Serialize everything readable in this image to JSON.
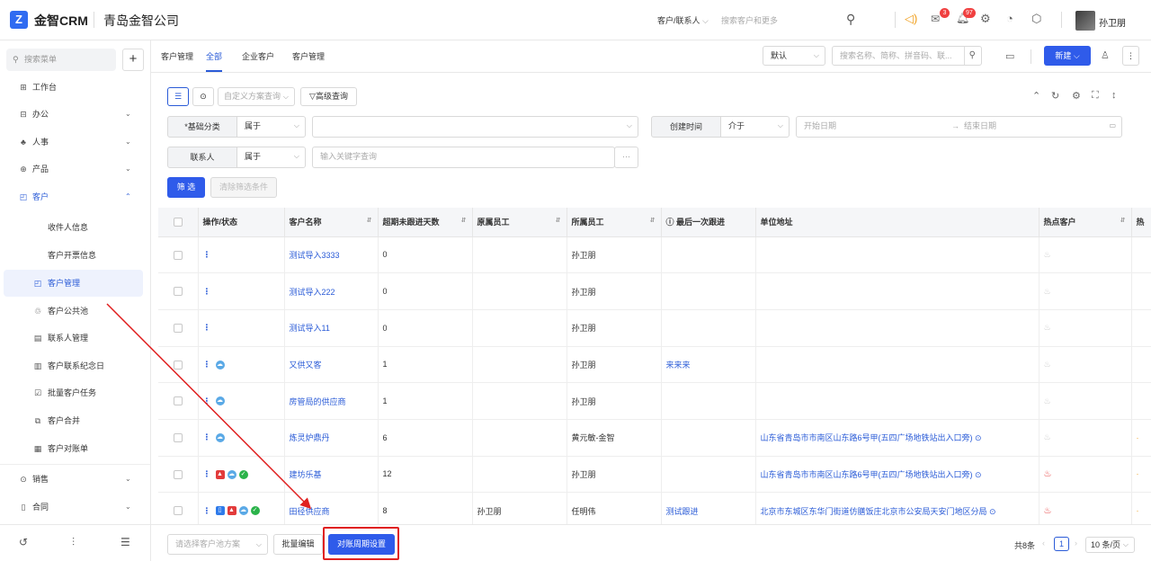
{
  "app": {
    "logo_letter": "Z",
    "name": "金智CRM",
    "company": "青岛金智公司"
  },
  "topbar": {
    "filter_label": "客户/联系人",
    "search_placeholder": "搜索客户和更多",
    "mail_badge": "3",
    "notify_badge": "97",
    "username": "孙卫朋"
  },
  "sidebar": {
    "search_placeholder": "搜索菜单",
    "items": [
      {
        "icon": "⊞",
        "label": "工作台"
      },
      {
        "icon": "⊟",
        "label": "办公"
      },
      {
        "icon": "♣",
        "label": "人事"
      },
      {
        "icon": "⊕",
        "label": "产品"
      },
      {
        "icon": "◰",
        "label": "客户"
      }
    ],
    "sub_items": [
      {
        "icon": "",
        "label": "收件人信息"
      },
      {
        "icon": "",
        "label": "客户开票信息"
      },
      {
        "icon": "◰",
        "label": "客户管理"
      },
      {
        "icon": "♲",
        "label": "客户公共池"
      },
      {
        "icon": "▤",
        "label": "联系人管理"
      },
      {
        "icon": "▥",
        "label": "客户联系纪念日"
      },
      {
        "icon": "☑",
        "label": "批量客户任务"
      },
      {
        "icon": "⧉",
        "label": "客户合并"
      },
      {
        "icon": "▦",
        "label": "客户对账单"
      }
    ],
    "tail_items": [
      {
        "icon": "⊙",
        "label": "销售"
      },
      {
        "icon": "▯",
        "label": "合同"
      }
    ]
  },
  "tabs": {
    "title": "客户管理",
    "items": [
      "全部",
      "企业客户",
      "客户管理"
    ],
    "view_select": "默认",
    "search_placeholder": "搜索名称、简称、拼音码、联...",
    "new_button": "新建"
  },
  "filters": {
    "scheme_placeholder": "自定义方案查询",
    "advanced": "高级查询",
    "base_category_label": "*基础分类",
    "base_op": "属于",
    "created_label": "创建时间",
    "created_op": "介于",
    "start_placeholder": "开始日期",
    "end_placeholder": "结束日期",
    "contact_label": "联系人",
    "contact_op": "属于",
    "keyword_placeholder": "输入关键字查询",
    "filter_btn": "筛 选",
    "clear_btn": "清除筛选条件"
  },
  "table": {
    "columns": [
      "操作/状态",
      "客户名称",
      "超期未跟进天数",
      "原属员工",
      "所属员工",
      "最后一次跟进",
      "单位地址",
      "热点客户",
      "热"
    ],
    "rows": [
      {
        "status": [],
        "name": "测试导入3333",
        "days": "0",
        "orig": "",
        "owner": "孙卫朋",
        "last": "",
        "addr": "",
        "hot": "grey"
      },
      {
        "status": [],
        "name": "测试导入222",
        "days": "0",
        "orig": "",
        "owner": "孙卫朋",
        "last": "",
        "addr": "",
        "hot": "grey"
      },
      {
        "status": [],
        "name": "测试导入11",
        "days": "0",
        "orig": "",
        "owner": "孙卫朋",
        "last": "",
        "addr": "",
        "hot": "grey"
      },
      {
        "status": [
          "lb"
        ],
        "name": "又供又客",
        "days": "1",
        "orig": "",
        "owner": "孙卫朋",
        "last": "来来来",
        "addr": "",
        "hot": "grey"
      },
      {
        "status": [
          "lb"
        ],
        "name": "房管局的供应商",
        "days": "1",
        "orig": "",
        "owner": "孙卫朋",
        "last": "",
        "addr": "",
        "hot": "grey"
      },
      {
        "status": [
          "lb"
        ],
        "name": "炼灵炉鼎丹",
        "days": "6",
        "orig": "",
        "owner": "黄元敏-金智",
        "last": "",
        "addr": "山东省青岛市市南区山东路6号甲(五四广场地铁站出入口旁)",
        "hot": "grey"
      },
      {
        "status": [
          "red",
          "lb",
          "green"
        ],
        "name": "建坊乐基",
        "days": "12",
        "orig": "",
        "owner": "孙卫朋",
        "last": "",
        "addr": "山东省青岛市市南区山东路6号甲(五四广场地铁站出入口旁)",
        "hot": "red"
      },
      {
        "status": [
          "blue",
          "red",
          "lb",
          "green"
        ],
        "name": "田径供应商",
        "days": "8",
        "orig": "孙卫朋",
        "owner": "任明伟",
        "last": "测试跟进",
        "addr": "北京市东城区东华门街道仿膳饭庄北京市公安局天安门地区分局",
        "hot": "red"
      }
    ]
  },
  "bottom": {
    "pool_placeholder": "请选择客户池方案",
    "batch_edit": "批量编辑",
    "reconcile": "对账周期设置",
    "total": "共8条",
    "page": "1",
    "page_size": "10 条/页"
  }
}
